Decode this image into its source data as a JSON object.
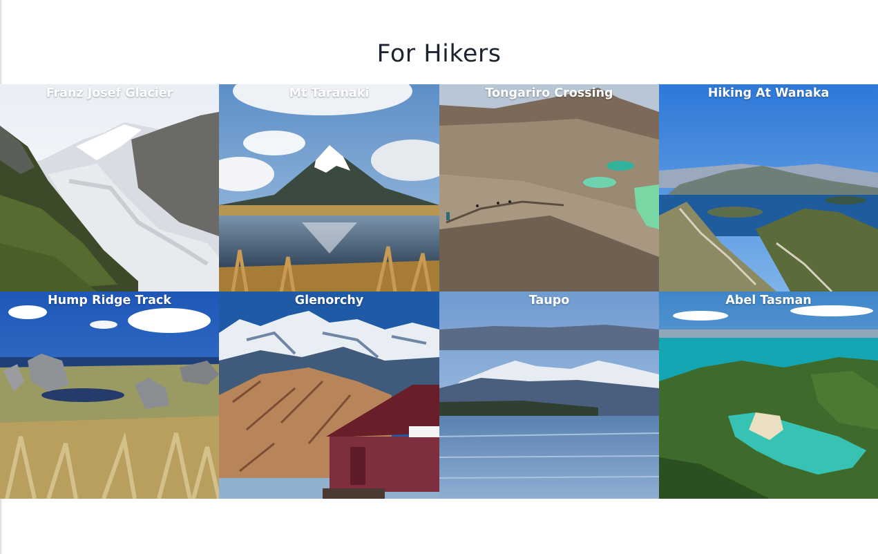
{
  "section": {
    "title": "For Hikers"
  },
  "destinations": [
    {
      "label": "Franz Josef Glacier",
      "photo": "glacier-valley-photo"
    },
    {
      "label": "Mt Taranaki",
      "photo": "volcano-reflection-photo"
    },
    {
      "label": "Tongariro Crossing",
      "photo": "emerald-lakes-photo"
    },
    {
      "label": "Hiking At Wanaka",
      "photo": "lake-wanaka-ridge-photo"
    },
    {
      "label": "Hump Ridge Track",
      "photo": "tussock-rocks-photo"
    },
    {
      "label": "Glenorchy",
      "photo": "red-shed-mountains-photo"
    },
    {
      "label": "Taupo",
      "photo": "lake-taupo-photo"
    },
    {
      "label": "Abel Tasman",
      "photo": "turquoise-bay-photo"
    }
  ]
}
